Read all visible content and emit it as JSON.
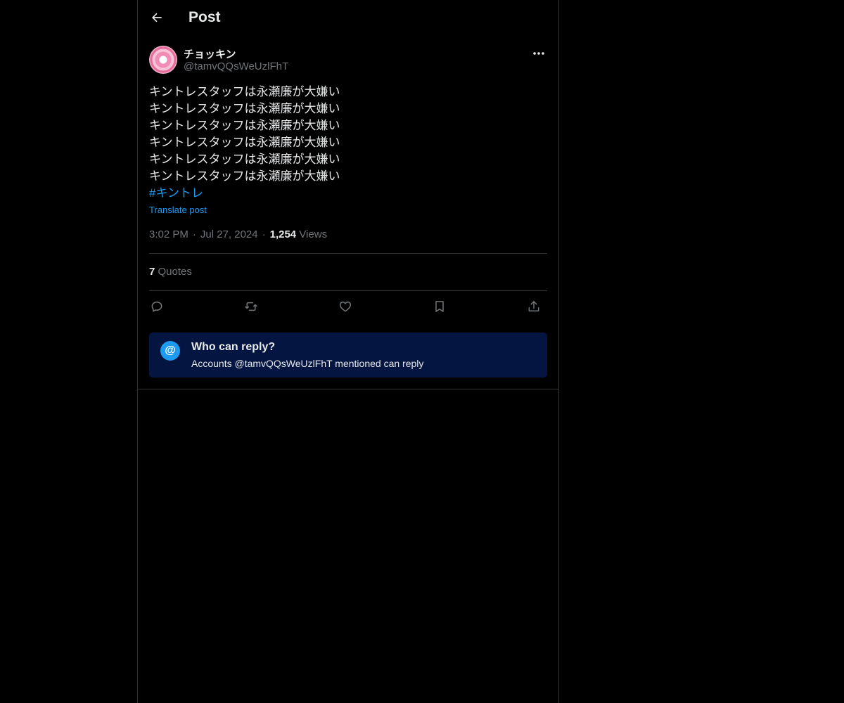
{
  "header": {
    "back_icon": "arrow-left-icon",
    "title": "Post"
  },
  "author": {
    "display_name": "チョッキン",
    "handle": "@tamvQQsWeUzlFhT",
    "more_icon": "more-dots-icon"
  },
  "post": {
    "lines": [
      "キントレスタッフは永瀬廉が大嫌い",
      "キントレスタッフは永瀬廉が大嫌い",
      "キントレスタッフは永瀬廉が大嫌い",
      "キントレスタッフは永瀬廉が大嫌い",
      "キントレスタッフは永瀬廉が大嫌い",
      "キントレスタッフは永瀬廉が大嫌い"
    ],
    "hashtag": "#キントレ",
    "translate_label": "Translate post"
  },
  "meta": {
    "time": "3:02 PM",
    "separator": "·",
    "date": "Jul 27, 2024",
    "views_count": "1,254",
    "views_label": "Views"
  },
  "quotes": {
    "count": "7",
    "label": "Quotes"
  },
  "actions": [
    {
      "icon": "reply-icon"
    },
    {
      "icon": "repost-icon"
    },
    {
      "icon": "like-icon"
    },
    {
      "icon": "bookmark-icon"
    },
    {
      "icon": "share-icon"
    }
  ],
  "reply_restriction": {
    "icon": "at-icon",
    "icon_glyph": "@",
    "title": "Who can reply?",
    "subtitle": "Accounts @tamvQQsWeUzlFhT mentioned can reply"
  },
  "colors": {
    "background": "#000000",
    "text": "#e7e9ea",
    "muted": "#71767b",
    "accent": "#1d9bf0",
    "border": "#2f3336",
    "notice_bg": "#031540"
  }
}
